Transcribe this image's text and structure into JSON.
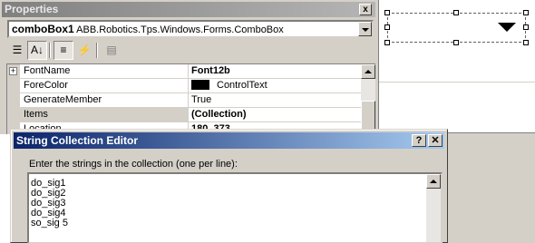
{
  "properties": {
    "title": "Properties",
    "close_glyph": "x",
    "object": {
      "name": "comboBox1",
      "type": "ABB.Robotics.Tps.Windows.Forms.ComboBox"
    },
    "toolbar": [
      {
        "icon": "categorized-icon",
        "glyph": "☰"
      },
      {
        "icon": "alphabetical-icon",
        "glyph": "A↓"
      },
      {
        "icon": "properties-icon",
        "glyph": "≡"
      },
      {
        "icon": "events-icon",
        "glyph": "⚡"
      },
      {
        "icon": "property-pages-icon",
        "glyph": "▤"
      }
    ],
    "rows": [
      {
        "name": "FontName",
        "value": "Font12b",
        "expand": "+"
      },
      {
        "name": "ForeColor",
        "value": "ControlText"
      },
      {
        "name": "GenerateMember",
        "value": "True"
      },
      {
        "name": "Items",
        "value": "(Collection)"
      },
      {
        "name": "Location",
        "value": "180, 373"
      }
    ]
  },
  "dialog": {
    "title": "String Collection Editor",
    "help_glyph": "?",
    "close_glyph": "✕",
    "prompt": "Enter the strings in the collection (one per line):",
    "lines": [
      "do_sig1",
      "do_sig2",
      "do_sig3",
      "do_sig4",
      "so_sig 5"
    ]
  },
  "colors": {
    "titlebar_active": "#0a246a",
    "titlebar_inactive": "#808080",
    "face": "#d4d0c8"
  }
}
